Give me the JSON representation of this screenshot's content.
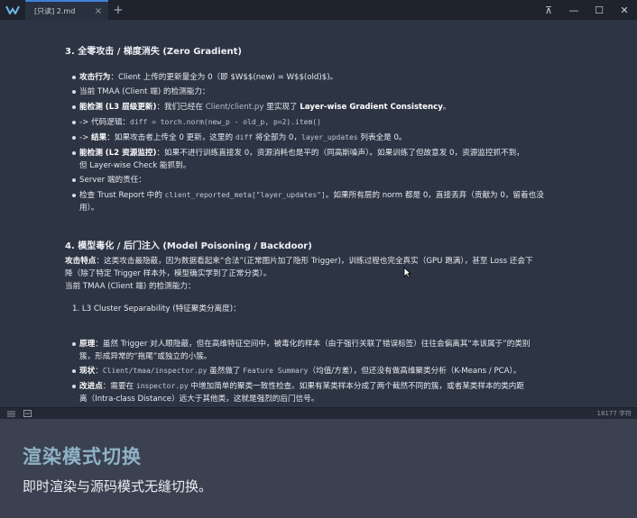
{
  "tab": {
    "title": "[只读] 2.md",
    "close": "×",
    "add": "+"
  },
  "window_controls": {
    "pin": "⊼",
    "minimize": "—",
    "maximize": "☐",
    "close": "✕"
  },
  "doc": {
    "s3_title": "3. 全零攻击 / 梯度消失 (Zero Gradient)",
    "s3_l1_label": "攻击行为",
    "s3_l1_text": "：Client 上传的更新量全为 0（即 $W$$(new) = W$$(old)$)。",
    "s3_l2": "当前 TMAA (Client 端) 的检测能力：",
    "s3_l3_label": "能检测 (L3 层级更新)",
    "s3_l3_text_a": "：我们已经在 ",
    "s3_l3_path": "Client/client.py",
    "s3_l3_text_b": " 里实现了 ",
    "s3_l3_bold": "Layer-wise Gradient Consistency",
    "s3_l3_end": "。",
    "s3_l4_prefix": "-> 代码逻辑：",
    "s3_l4_code": "diff = torch.norm(new_p - old_p, p=2).item()",
    "s3_l5_prefix": "-> ",
    "s3_l5_label": "结果",
    "s3_l5_a": "：如果攻击者上传全 0 更新，这里的 ",
    "s3_l5_code1": "diff",
    "s3_l5_b": " 将全部为 0，",
    "s3_l5_code2": "layer_updates",
    "s3_l5_c": " 列表全是 0。",
    "s3_l6_label": "能检测 (L2 资源监控)",
    "s3_l6_text": "：如果不进行训练直接发 0，资源消耗也是平的（同高斯噪声）。如果训练了但故意发 0，资源监控抓不到，",
    "s3_l6_cont": "但 Layer-wise Check 能抓到。",
    "s3_l7": "Server 端的责任：",
    "s3_l8_a": "检查 Trust Report 中的 ",
    "s3_l8_code": "client_reported_meta[\"layer_updates\"]",
    "s3_l8_b": "。如果所有层的 norm 都是 0，直接丢弃（贡献为 0，留着也没",
    "s3_l8_cont": "用）。",
    "s4_title": "4. 模型毒化 / 后门注入 (Model Poisoning / Backdoor)",
    "s4_p1_label": "攻击特点",
    "s4_p1_text": "：这类攻击最隐蔽，因为数据看起来“合法”(正常图片加了隐形 Trigger)，训练过程也完全真实（GPU 跑满），甚至 Loss 还会下",
    "s4_p1_cont": "降（除了特定 Trigger 样本外，模型确实学到了正常分类）。",
    "s4_p2": "当前 TMAA (Client 端) 的检测能力：",
    "s4_ol1": "1. L3 Cluster Separability (特征聚类分离度)：",
    "s4_b1_label": "原理",
    "s4_b1_text": "：虽然 Trigger 对人眼隐蔽，但在高维特征空间中，被毒化的样本（由于强行关联了错误标签）往往会偏离其“本该属于”的类别",
    "s4_b1_cont": "簇，形成异常的“拖尾”或独立的小簇。",
    "s4_b2_label": "现状",
    "s4_b2_a": "：",
    "s4_b2_code1": "Client/tmaa/inspector.py",
    "s4_b2_b": " 虽然做了 ",
    "s4_b2_code2": "Feature Summary",
    "s4_b2_c": "（均值/方差），但还没有做高维聚类分析（K-Means / PCA）。",
    "s4_b3_label": "改进点",
    "s4_b3_a": "：需要在 ",
    "s4_b3_code": "inspector.py",
    "s4_b3_b": " 中增加简单的聚类一致性检查。如果有某类样本分成了两个截然不同的簇，或者某类样本的类内距",
    "s4_b3_cont": "离（Intra-class Distance）远大于其他类，这就是强烈的后门信号。"
  },
  "status": {
    "char_count": "18177 字符"
  },
  "promo": {
    "title": "渲染模式切换",
    "subtitle": "即时渲染与源码模式无缝切换。"
  }
}
